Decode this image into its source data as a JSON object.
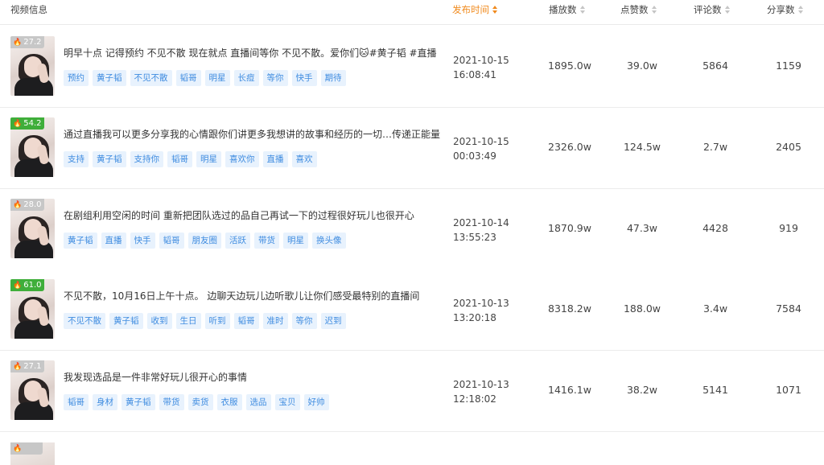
{
  "header": {
    "video_info": "视频信息",
    "publish_time": "发布时间",
    "plays": "播放数",
    "likes": "点赞数",
    "comments": "评论数",
    "shares": "分享数"
  },
  "rows": [
    {
      "hot": "27.2",
      "hot_color": "#c7c7c7",
      "title": "明早十点 记得预约 不见不散 现在就点 直播间等你 不见不散。爱你们🐱#黄子韬 #直播",
      "tags": [
        "预约",
        "黄子韬",
        "不见不散",
        "韬哥",
        "明星",
        "长痘",
        "等你",
        "快手",
        "期待"
      ],
      "date": "2021-10-15",
      "clock": "16:08:41",
      "plays": "1895.0w",
      "likes": "39.0w",
      "comments": "5864",
      "shares": "1159"
    },
    {
      "hot": "54.2",
      "hot_color": "#3fae3a",
      "title": "通过直播我可以更多分享我的心情跟你们讲更多我想讲的故事和经历的一切…传递正能量",
      "tags": [
        "支持",
        "黄子韬",
        "支持你",
        "韬哥",
        "明星",
        "喜欢你",
        "直播",
        "喜欢"
      ],
      "date": "2021-10-15",
      "clock": "00:03:49",
      "plays": "2326.0w",
      "likes": "124.5w",
      "comments": "2.7w",
      "shares": "2405"
    },
    {
      "hot": "28.0",
      "hot_color": "#c7c7c7",
      "title": "在剧组利用空闲的时间 重新把团队选过的品自己再试一下的过程很好玩儿也很开心",
      "tags": [
        "黄子韬",
        "直播",
        "快手",
        "韬哥",
        "朋友圈",
        "活跃",
        "带货",
        "明星",
        "换头像"
      ],
      "date": "2021-10-14",
      "clock": "13:55:23",
      "plays": "1870.9w",
      "likes": "47.3w",
      "comments": "4428",
      "shares": "919"
    },
    {
      "hot": "61.0",
      "hot_color": "#3fae3a",
      "title": "不见不散，10月16日上午十点。 边聊天边玩儿边听歌儿让你们感受最特别的直播间",
      "tags": [
        "不见不散",
        "黄子韬",
        "收到",
        "生日",
        "听到",
        "韬哥",
        "准时",
        "等你",
        "迟到"
      ],
      "date": "2021-10-13",
      "clock": "13:20:18",
      "plays": "8318.2w",
      "likes": "188.0w",
      "comments": "3.4w",
      "shares": "7584"
    },
    {
      "hot": "27.1",
      "hot_color": "#c7c7c7",
      "title": "我发现选品是一件非常好玩儿很开心的事情",
      "tags": [
        "韬哥",
        "身材",
        "黄子韬",
        "带货",
        "卖货",
        "衣服",
        "选品",
        "宝贝",
        "好帅"
      ],
      "date": "2021-10-13",
      "clock": "12:18:02",
      "plays": "1416.1w",
      "likes": "38.2w",
      "comments": "5141",
      "shares": "1071"
    }
  ]
}
